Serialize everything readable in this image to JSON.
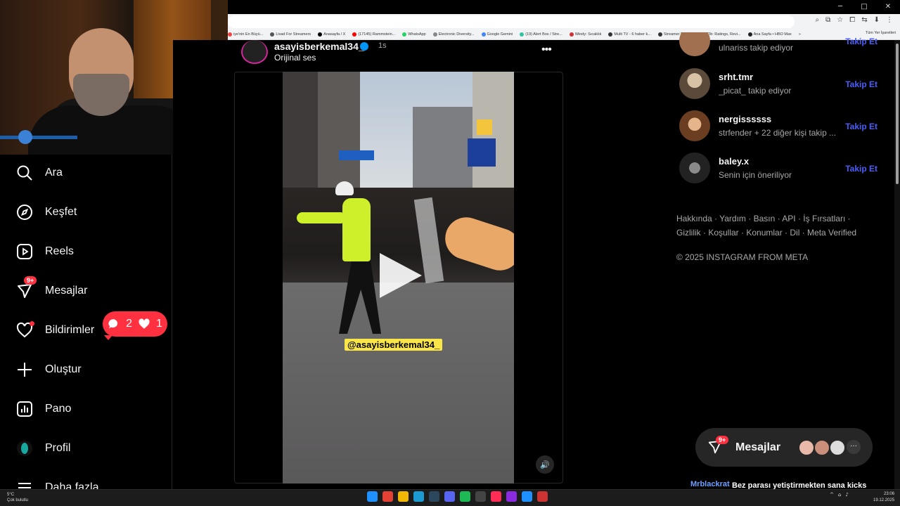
{
  "browser": {
    "window_controls": [
      "─",
      "□",
      "✕"
    ],
    "address_icons": [
      "⌕",
      "⧉",
      "☆",
      "⧠",
      "⇆",
      "⬇",
      "⋮"
    ],
    "bookmarks": [
      {
        "label": "iye'nin En Büyü...",
        "color": "#e44"
      },
      {
        "label": "Livad For Streamers",
        "color": "#555"
      },
      {
        "label": "Anasayfa / X",
        "color": "#000"
      },
      {
        "label": "(17145) Rammstein...",
        "color": "#f00"
      },
      {
        "label": "WhatsApp",
        "color": "#25d366"
      },
      {
        "label": "Electronic Diversity...",
        "color": "#888"
      },
      {
        "label": "Google Gemini",
        "color": "#4285f4"
      },
      {
        "label": "(19) Alert Box / Stre...",
        "color": "#31c3a2"
      },
      {
        "label": "Windy: Sıcaklık",
        "color": "#c33"
      },
      {
        "label": "Multi TV - 6 haber k...",
        "color": "#333"
      },
      {
        "label": "Streamer Panel",
        "color": "#333"
      },
      {
        "label": "IMDb: Ratings, Revi...",
        "color": "#f5c518"
      },
      {
        "label": "Ana Sayfa • HBO Max",
        "color": "#222"
      }
    ],
    "bookmarks_overflow": "»",
    "all_bookmarks": "Tüm Yer İşaretleri"
  },
  "sidebar": {
    "items": [
      {
        "label": "Ara",
        "icon": "search-icon"
      },
      {
        "label": "Keşfet",
        "icon": "compass-icon"
      },
      {
        "label": "Reels",
        "icon": "reels-icon"
      },
      {
        "label": "Mesajlar",
        "icon": "messenger-icon",
        "badge": "9+"
      },
      {
        "label": "Bildirimler",
        "icon": "heart-icon"
      },
      {
        "label": "Oluştur",
        "icon": "plus-icon"
      },
      {
        "label": "Pano",
        "icon": "dashboard-icon"
      },
      {
        "label": "Profil",
        "icon": "avatar-icon"
      },
      {
        "label": "Daha fazla",
        "icon": "menu-icon"
      }
    ],
    "notification_pill": {
      "comments": "2",
      "likes": "1"
    }
  },
  "post": {
    "username": "asayisberkemal34_",
    "time": "1s",
    "audio": "Orijinal ses",
    "more": "•••",
    "video_tag": "@asayisberkemal34_"
  },
  "suggestions": [
    {
      "name": "",
      "sub": "ulnariss takip ediyor",
      "follow": "Takip Et",
      "color": "#a07050"
    },
    {
      "name": "srht.tmr",
      "sub": "_picat_ takip ediyor",
      "follow": "Takip Et",
      "color": "#b8a48c"
    },
    {
      "name": "nergissssss",
      "sub": "strfender + 22 diğer kişi takip ...",
      "follow": "Takip Et",
      "color": "#8b5a3a"
    },
    {
      "name": "baley.x",
      "sub": "Senin için öneriliyor",
      "follow": "Takip Et",
      "color": "#4a4a4a"
    }
  ],
  "footer": {
    "links": "Hakkında · Yardım · Basın · API · İş Fırsatları · Gizlilik · Koşullar · Konumlar · Dil · Meta Verified",
    "copyright": "© 2025 INSTAGRAM FROM META"
  },
  "messages_pill": {
    "label": "Mesajlar",
    "badge": "9+",
    "more": "···"
  },
  "chat": {
    "user": "Mrblackrat",
    "message": "Bez parası yetiştirmekten sana kicks kalmıyor hakkını helal et"
  },
  "taskbar": {
    "weather_temp": "5°C",
    "weather_desc": "Çok bulutlu",
    "time": "23:06",
    "date": "19.12.2025",
    "app_colors": [
      "#1e90ff",
      "#e34133",
      "#f2b705",
      "#1b9bd1",
      "#2a475e",
      "#5865f2",
      "#1db954",
      "#444",
      "#ff2d55",
      "#8a2be2",
      "#1e90ff",
      "#c33"
    ]
  }
}
